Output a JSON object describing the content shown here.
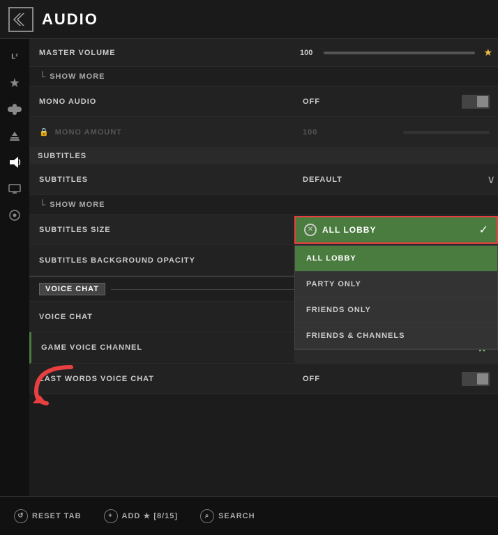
{
  "header": {
    "title": "AUDIO",
    "icon_label": "audio-icon"
  },
  "sidebar": {
    "items": [
      {
        "id": "level-icon",
        "symbol": "L²",
        "active": false
      },
      {
        "id": "star-icon",
        "symbol": "★",
        "active": false
      },
      {
        "id": "gamepad-icon",
        "symbol": "⌂",
        "active": false
      },
      {
        "id": "pencil-icon",
        "symbol": "✎",
        "active": false
      },
      {
        "id": "speaker-icon",
        "symbol": "🔊",
        "active": true
      },
      {
        "id": "display-icon",
        "symbol": "▣",
        "active": false
      },
      {
        "id": "network-icon",
        "symbol": "◉",
        "active": false
      }
    ]
  },
  "settings": {
    "master_volume_label": "MASTER VOLUME",
    "master_volume_value": "100",
    "show_more_label": "SHOW MORE",
    "mono_audio_label": "MONO AUDIO",
    "mono_audio_value": "OFF",
    "mono_amount_label": "MONO AMOUNT",
    "mono_amount_value": "100",
    "subtitles_section": "SUBTITLES",
    "subtitles_label": "SUBTITLES",
    "subtitles_value": "DEFAULT",
    "subtitles_show_more": "SHOW MORE",
    "subtitles_size_label": "SUBTITLES SIZE",
    "subtitles_background_label": "SUBTITLES BACKGROUND OPACITY",
    "voice_chat_badge": "VOICE CHAT",
    "voice_chat_label": "VOICE CHAT",
    "game_voice_channel_label": "GAME VOICE CHANNEL",
    "game_voice_channel_value": "ALL LOBBY",
    "last_words_label": "LAST WORDS VOICE CHAT",
    "last_words_value": "OFF"
  },
  "dropdown": {
    "selected": "ALL LOBBY",
    "options": [
      {
        "id": "all-lobby",
        "label": "ALL LOBBY",
        "highlighted": true
      },
      {
        "id": "party-only",
        "label": "PARTY ONLY",
        "highlighted": false
      },
      {
        "id": "friends-only",
        "label": "FRIENDS ONLY",
        "highlighted": false
      },
      {
        "id": "friends-channels",
        "label": "FRIENDS & CHANNELS",
        "highlighted": false
      }
    ]
  },
  "bottom_bar": {
    "reset_label": "RESET TAB",
    "add_label": "ADD ★ [8/15]",
    "search_label": "SEARCH"
  }
}
